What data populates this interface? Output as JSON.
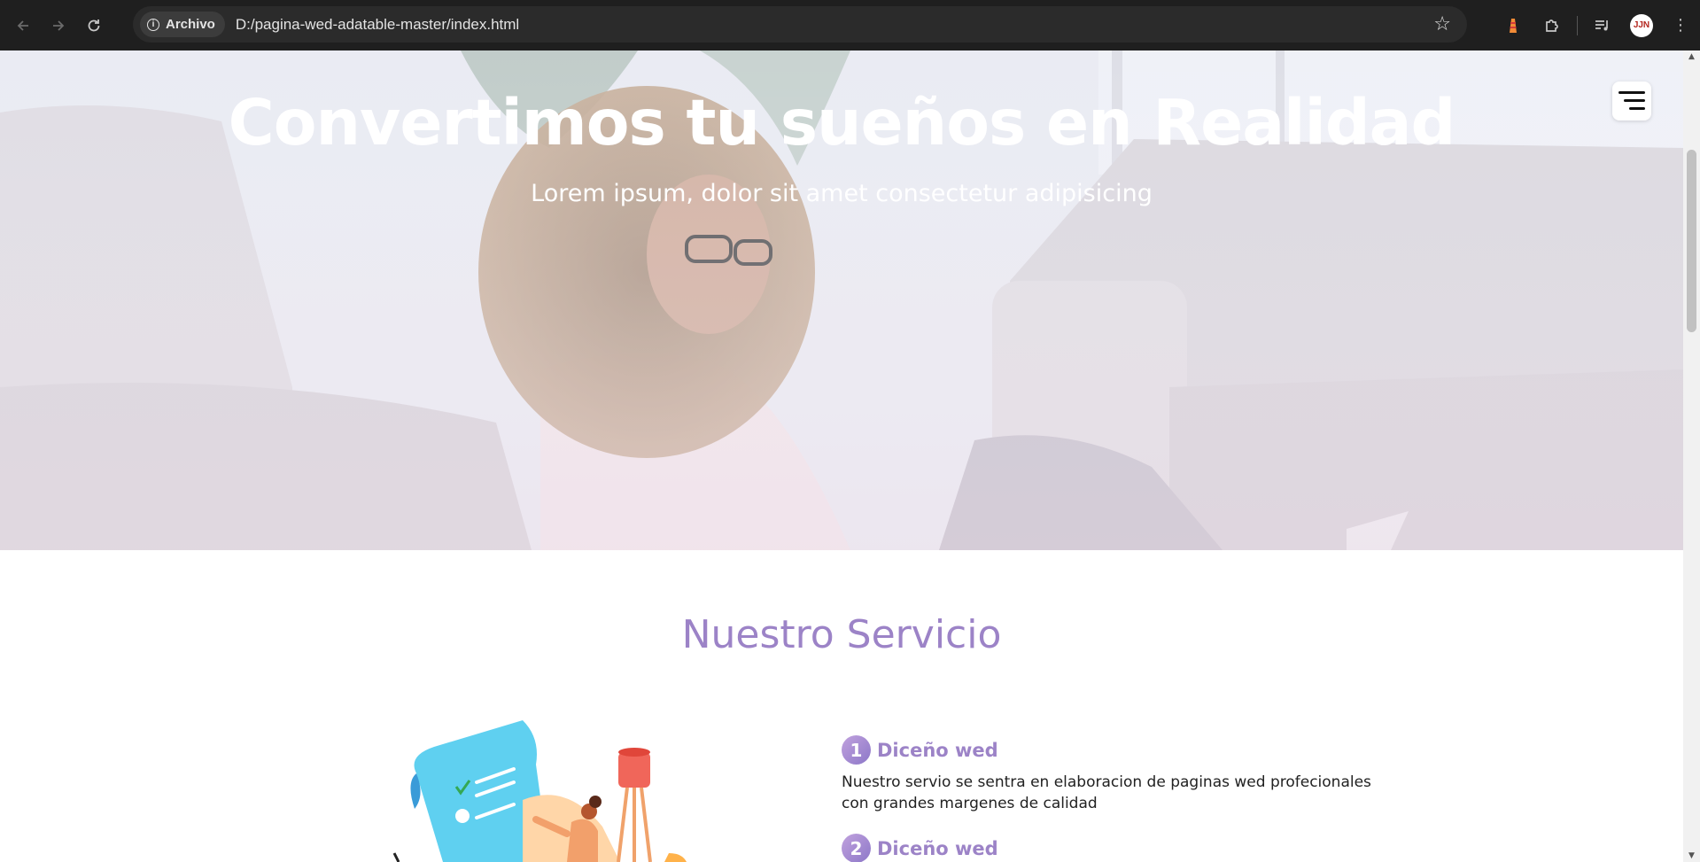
{
  "browser": {
    "chip_label": "Archivo",
    "url": "D:/pagina-wed-adatable-master/index.html",
    "avatar_initials": "JJN"
  },
  "hero": {
    "title": "Convertimos tu sueños en Realidad",
    "subtitle": "Lorem ipsum, dolor sit amet consectetur adipisicing"
  },
  "services": {
    "title": "Nuestro Servicio",
    "items": [
      {
        "number": "1",
        "title": "Diceño wed",
        "description": "Nuestro servio se sentra en elaboracion de paginas wed profecionales con grandes margenes de calidad"
      },
      {
        "number": "2",
        "title": "Diceño wed"
      }
    ]
  },
  "colors": {
    "accent": "#9c83c7",
    "chrome": "#1f1f1f"
  }
}
